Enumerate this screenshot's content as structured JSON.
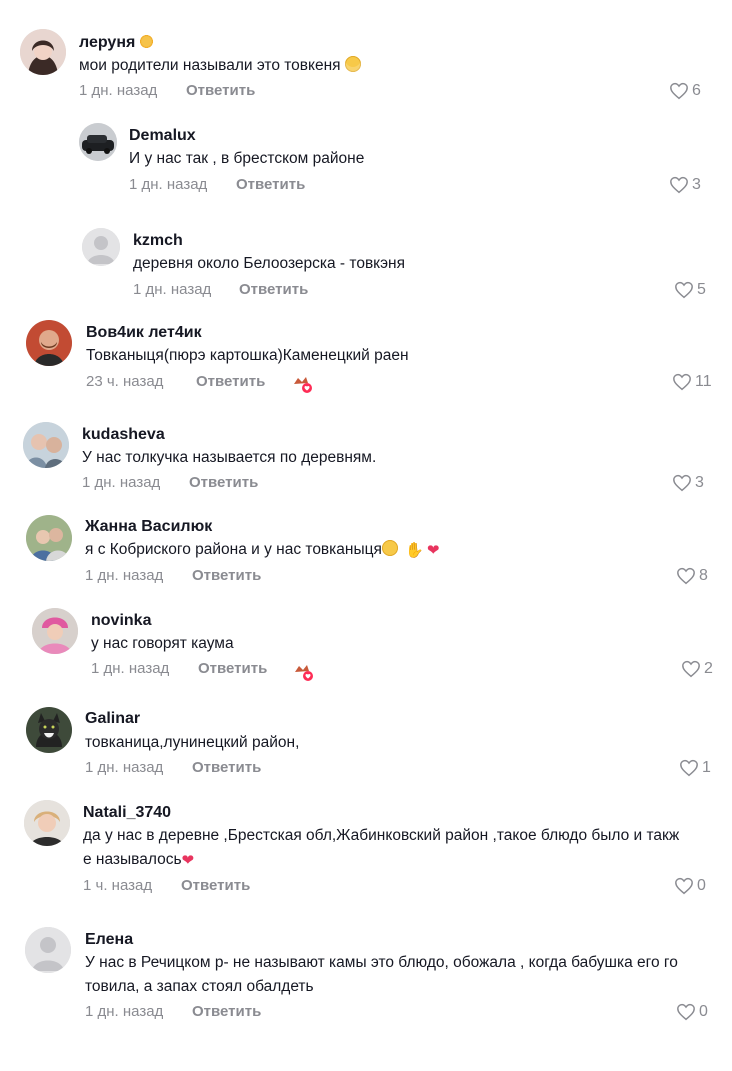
{
  "reply_label": "Ответить",
  "comments": [
    {
      "name": "леруня",
      "text": "мои родители называли это товкеня",
      "time": "1 дн. назад",
      "likes": "6"
    },
    {
      "name": "Demalux",
      "text": "И у нас так , в брестском районе",
      "time": "1 дн. назад",
      "likes": "3"
    },
    {
      "name": "kzmch",
      "text": "деревня около Белоозерска - товкэня",
      "time": "1 дн. назад",
      "likes": "5"
    },
    {
      "name": "Вов4ик лет4ик",
      "text": "Товканыця(пюрэ картошка)Каменецкий раен",
      "time": "23 ч. назад",
      "likes": "11"
    },
    {
      "name": "kudasheva",
      "text": "У нас толкучка называется по деревням.",
      "time": "1 дн. назад",
      "likes": "3"
    },
    {
      "name": "Жанна Василюк",
      "text": "я с Кобриского района и у нас товканыця",
      "time": "1 дн. назад",
      "likes": "8"
    },
    {
      "name": "novinka",
      "text": "у нас говорят каума",
      "time": "1 дн. назад",
      "likes": "2"
    },
    {
      "name": "Galinar",
      "text": "товканица,лунинецкий район,",
      "time": "1 дн. назад",
      "likes": "1"
    },
    {
      "name": "Natali_3740",
      "text_line1": "да у нас в деревне ,Брестская обл,Жабинковский район ,такое блюдо было и такж",
      "text_line2": "е называлось",
      "time": "1 ч. назад",
      "likes": "0"
    },
    {
      "name": "Елена",
      "text_line1": "У нас в Речицком р- не называют камы это блюдо, обожала , когда бабушка его го",
      "text_line2": "товила, а запах стоял обалдеть",
      "time": "1 дн. назад",
      "likes": "0"
    }
  ]
}
